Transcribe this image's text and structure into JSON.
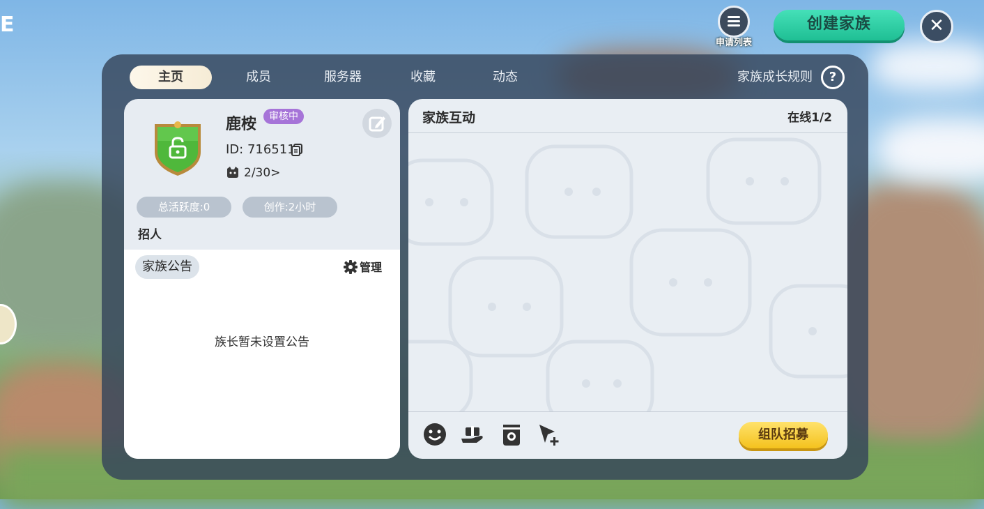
{
  "header": {
    "apply_list_label": "申请列表",
    "create_family_label": "创建家族"
  },
  "tabs": [
    {
      "label": "主页",
      "active": true
    },
    {
      "label": "成员",
      "active": false
    },
    {
      "label": "服务器",
      "active": false
    },
    {
      "label": "收藏",
      "active": false
    },
    {
      "label": "动态",
      "active": false
    }
  ],
  "rules_label": "家族成长规则",
  "family": {
    "name": "鹿桉",
    "status_badge": "审核中",
    "id_text": "ID: 716511",
    "members_text": "2/30>",
    "activity_pill": "总活跃度:0",
    "creation_pill": "创作:2小时",
    "recruit_label": "招人"
  },
  "notice": {
    "tag": "家族公告",
    "manage_label": "管理",
    "empty_text": "族长暂未设置公告"
  },
  "interaction": {
    "title": "家族互动",
    "online_text": "在线1/2",
    "team_recruit_label": "组队招募",
    "tools": [
      "emoji-icon",
      "gift-icon",
      "pouch-icon",
      "cursor-add-icon"
    ]
  },
  "colors": {
    "create_button": "#1fbf94",
    "team_button": "#f4c21e",
    "badge": "#a674d8",
    "panel": "#34445a",
    "shield": "#4fb83b"
  }
}
